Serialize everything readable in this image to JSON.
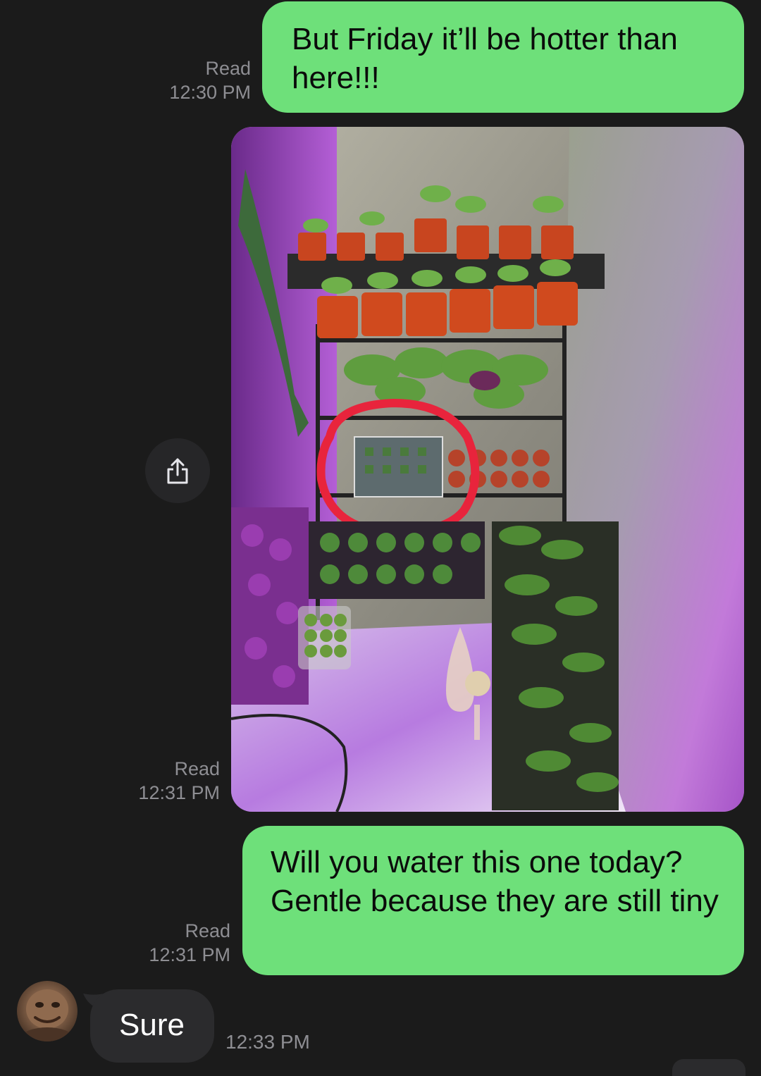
{
  "messages": [
    {
      "status": "Read",
      "time": "12:30 PM",
      "text": "But Friday it’ll be hotter than here!!!"
    },
    {
      "status": "Read",
      "time": "12:31 PM",
      "photo_description_name": "grow-tent-seedlings-photo"
    },
    {
      "status": "Read",
      "time": "12:31 PM",
      "text": "Will you water this one today? Gentle because they are still tiny"
    },
    {
      "text": "Sure",
      "time": "12:33 PM"
    }
  ],
  "icons": {
    "share": "share-icon",
    "avatar": "contact-avatar"
  },
  "colors": {
    "outgoing_bubble": "#6ee07a",
    "incoming_bubble": "#2b2b2d",
    "background": "#1b1b1b",
    "meta_text": "#8e8e93",
    "highlight_circle": "#e8243c"
  }
}
